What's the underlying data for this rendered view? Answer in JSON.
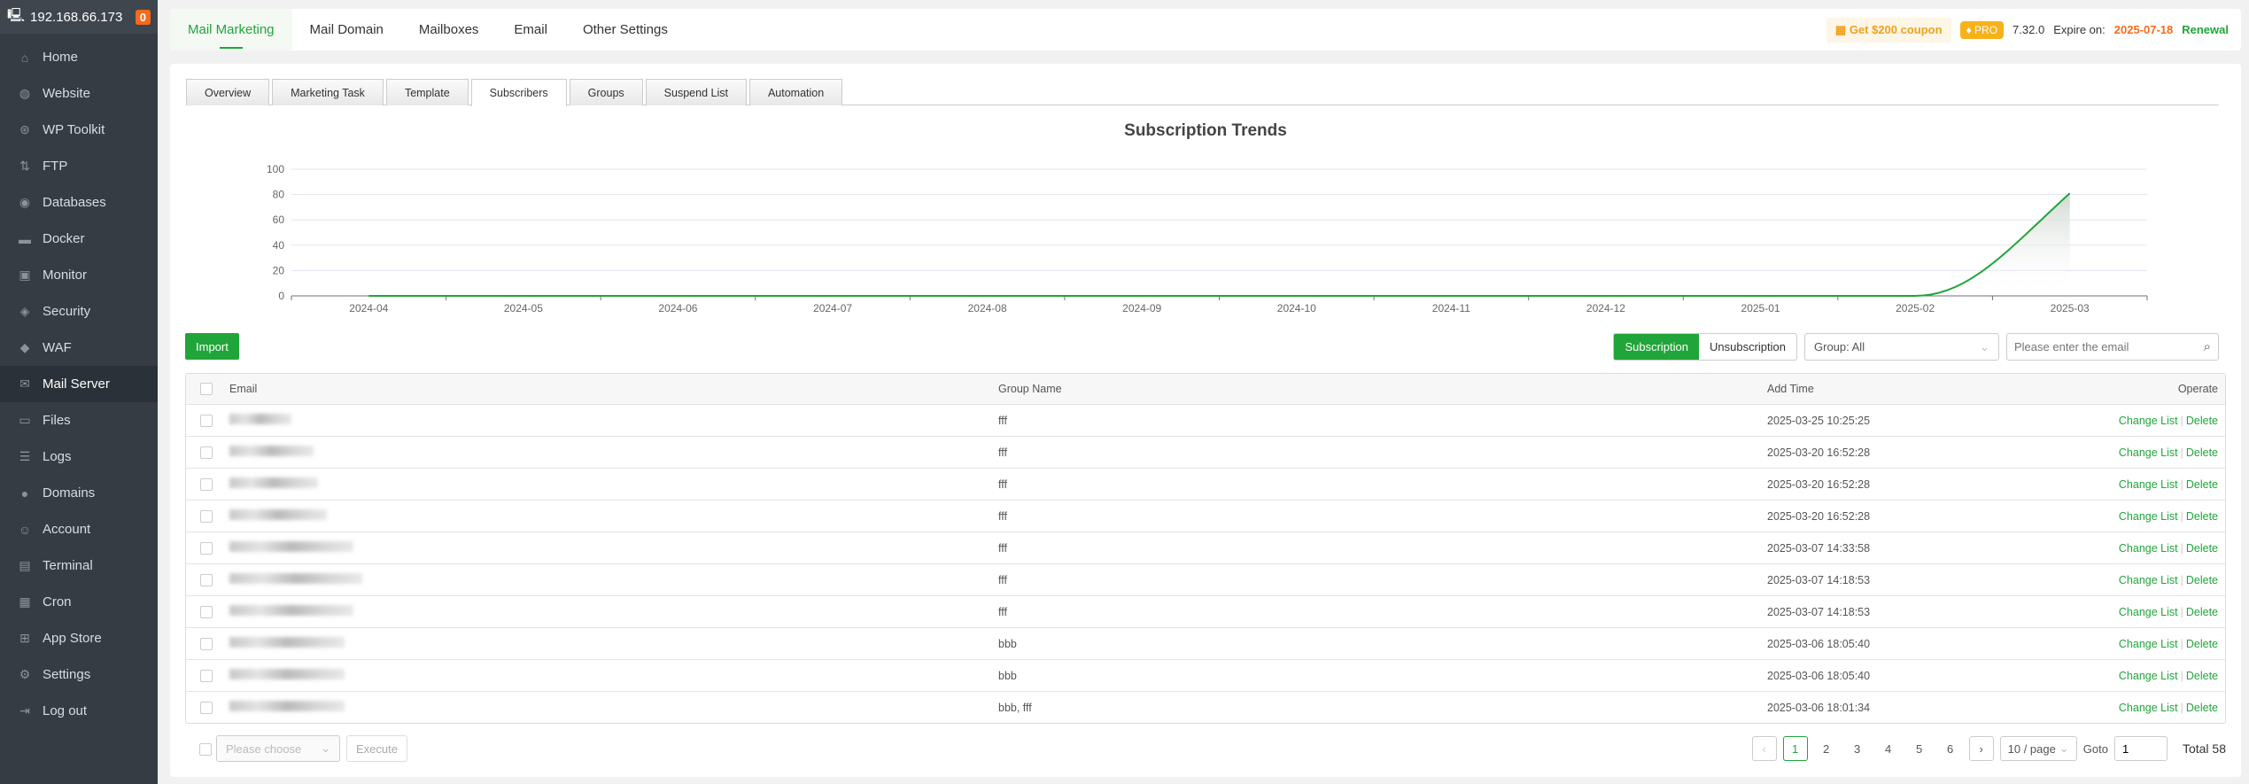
{
  "sidebar": {
    "server_ip": "192.168.66.173",
    "badge": "0",
    "items": [
      {
        "label": "Home",
        "icon": "home-icon",
        "glyph": "⌂"
      },
      {
        "label": "Website",
        "icon": "globe-icon",
        "glyph": "◍"
      },
      {
        "label": "WP Toolkit",
        "icon": "wordpress-icon",
        "glyph": "⊛"
      },
      {
        "label": "FTP",
        "icon": "ftp-icon",
        "glyph": "⇅"
      },
      {
        "label": "Databases",
        "icon": "database-icon",
        "glyph": "◉"
      },
      {
        "label": "Docker",
        "icon": "docker-icon",
        "glyph": "▬"
      },
      {
        "label": "Monitor",
        "icon": "monitor-icon",
        "glyph": "▣"
      },
      {
        "label": "Security",
        "icon": "shield-icon",
        "glyph": "◈"
      },
      {
        "label": "WAF",
        "icon": "waf-icon",
        "glyph": "◆"
      },
      {
        "label": "Mail Server",
        "icon": "mail-icon",
        "glyph": "✉"
      },
      {
        "label": "Files",
        "icon": "folder-icon",
        "glyph": "▭"
      },
      {
        "label": "Logs",
        "icon": "log-icon",
        "glyph": "☰"
      },
      {
        "label": "Domains",
        "icon": "domain-icon",
        "glyph": "●"
      },
      {
        "label": "Account",
        "icon": "user-icon",
        "glyph": "☺"
      },
      {
        "label": "Terminal",
        "icon": "terminal-icon",
        "glyph": "▤"
      },
      {
        "label": "Cron",
        "icon": "calendar-icon",
        "glyph": "▦"
      },
      {
        "label": "App Store",
        "icon": "apps-icon",
        "glyph": "⊞"
      },
      {
        "label": "Settings",
        "icon": "gear-icon",
        "glyph": "⚙"
      },
      {
        "label": "Log out",
        "icon": "logout-icon",
        "glyph": "⇥"
      }
    ],
    "active": "Mail Server"
  },
  "topnav": {
    "tabs": [
      "Mail Marketing",
      "Mail Domain",
      "Mailboxes",
      "Email",
      "Other Settings"
    ],
    "active": "Mail Marketing",
    "coupon": "Get $200 coupon",
    "pro": "PRO",
    "version": "7.32.0",
    "expire_label": "Expire on:",
    "expire_date": "2025-07-18",
    "renewal": "Renewal"
  },
  "subtabs": {
    "tabs": [
      "Overview",
      "Marketing Task",
      "Template",
      "Subscribers",
      "Groups",
      "Suspend List",
      "Automation"
    ],
    "active": "Subscribers"
  },
  "chart_data": {
    "type": "area",
    "title": "Subscription Trends",
    "categories": [
      "2024-04",
      "2024-05",
      "2024-06",
      "2024-07",
      "2024-08",
      "2024-09",
      "2024-10",
      "2024-11",
      "2024-12",
      "2025-01",
      "2025-02",
      "2025-03"
    ],
    "values": [
      0,
      0,
      0,
      0,
      0,
      0,
      0,
      0,
      0,
      0,
      0,
      81
    ],
    "yticks": [
      0,
      20,
      40,
      60,
      80,
      100
    ],
    "ylim": [
      0,
      100
    ],
    "grid": true,
    "line_color": "#20a53a"
  },
  "toolbar": {
    "import": "Import",
    "subscription": "Subscription",
    "unsubscription": "Unsubscription",
    "group_select": "Group: All",
    "search_placeholder": "Please enter the email"
  },
  "table": {
    "columns": [
      "Email",
      "Group Name",
      "Add Time",
      "Operate"
    ],
    "rows": [
      {
        "group": "fff",
        "time": "2025-03-25 10:25:25"
      },
      {
        "group": "fff",
        "time": "2025-03-20 16:52:28"
      },
      {
        "group": "fff",
        "time": "2025-03-20 16:52:28"
      },
      {
        "group": "fff",
        "time": "2025-03-20 16:52:28"
      },
      {
        "group": "fff",
        "time": "2025-03-07 14:33:58"
      },
      {
        "group": "fff",
        "time": "2025-03-07 14:18:53"
      },
      {
        "group": "fff",
        "time": "2025-03-07 14:18:53"
      },
      {
        "group": "bbb",
        "time": "2025-03-06 18:05:40"
      },
      {
        "group": "bbb",
        "time": "2025-03-06 18:05:40"
      },
      {
        "group": "bbb, fff",
        "time": "2025-03-06 18:01:34"
      }
    ],
    "op_change": "Change List",
    "op_delete": "Delete"
  },
  "footer": {
    "batch_placeholder": "Please choose",
    "execute": "Execute",
    "pages": [
      "1",
      "2",
      "3",
      "4",
      "5",
      "6"
    ],
    "current_page": "1",
    "page_size": "10 / page",
    "goto_label": "Goto",
    "goto_value": "1",
    "total": "Total 58"
  }
}
